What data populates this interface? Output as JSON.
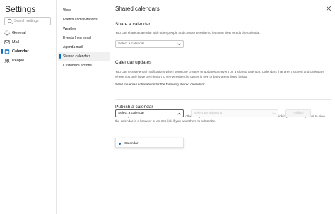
{
  "app": {
    "title": "Settings"
  },
  "search": {
    "placeholder": "Search settings"
  },
  "left_nav": [
    {
      "label": "General",
      "icon": "gear-icon",
      "active": false
    },
    {
      "label": "Mail",
      "icon": "mail-icon",
      "active": false
    },
    {
      "label": "Calendar",
      "icon": "calendar-icon",
      "active": true
    },
    {
      "label": "People",
      "icon": "people-icon",
      "active": false
    }
  ],
  "sub_nav": [
    {
      "label": "View",
      "active": false
    },
    {
      "label": "Events and invitations",
      "active": false
    },
    {
      "label": "Weather",
      "active": false
    },
    {
      "label": "Events from email",
      "active": false
    },
    {
      "label": "Agenda mail",
      "active": false
    },
    {
      "label": "Shared calendars",
      "active": true
    },
    {
      "label": "Customize actions",
      "active": false
    }
  ],
  "main": {
    "title": "Shared calendars",
    "share": {
      "title": "Share a calendar",
      "description": "You can share a calendar with other people and choose whether to let them view or edit the calendar.",
      "select_value": "Select a calendar"
    },
    "updates": {
      "title": "Calendar updates",
      "description": "You can receive email notifications when someone creates or updates an event on a shared calendar. Calendars that aren't shared and calendars where you only have permission to see whether the owner is free or busy aren't listed below.",
      "notify_text": "Send me email notifications for the following shared calendars:"
    },
    "publish": {
      "title": "Publish a calendar",
      "description": "You can publish a calendar and share a link with other people to let them view the calendar online. Use an HTML link if you want recipients to view the calendar in a browser or an ICS link if you want them to subscribe.",
      "select_value": "Select a calendar",
      "permission_placeholder": "Select permissions",
      "publish_label": "Publish"
    },
    "dropdown_options": [
      "Calendar"
    ]
  },
  "colors": {
    "accent": "#0f6cbd",
    "text": "#242424",
    "muted": "#616161",
    "border": "#e6e6e6"
  }
}
